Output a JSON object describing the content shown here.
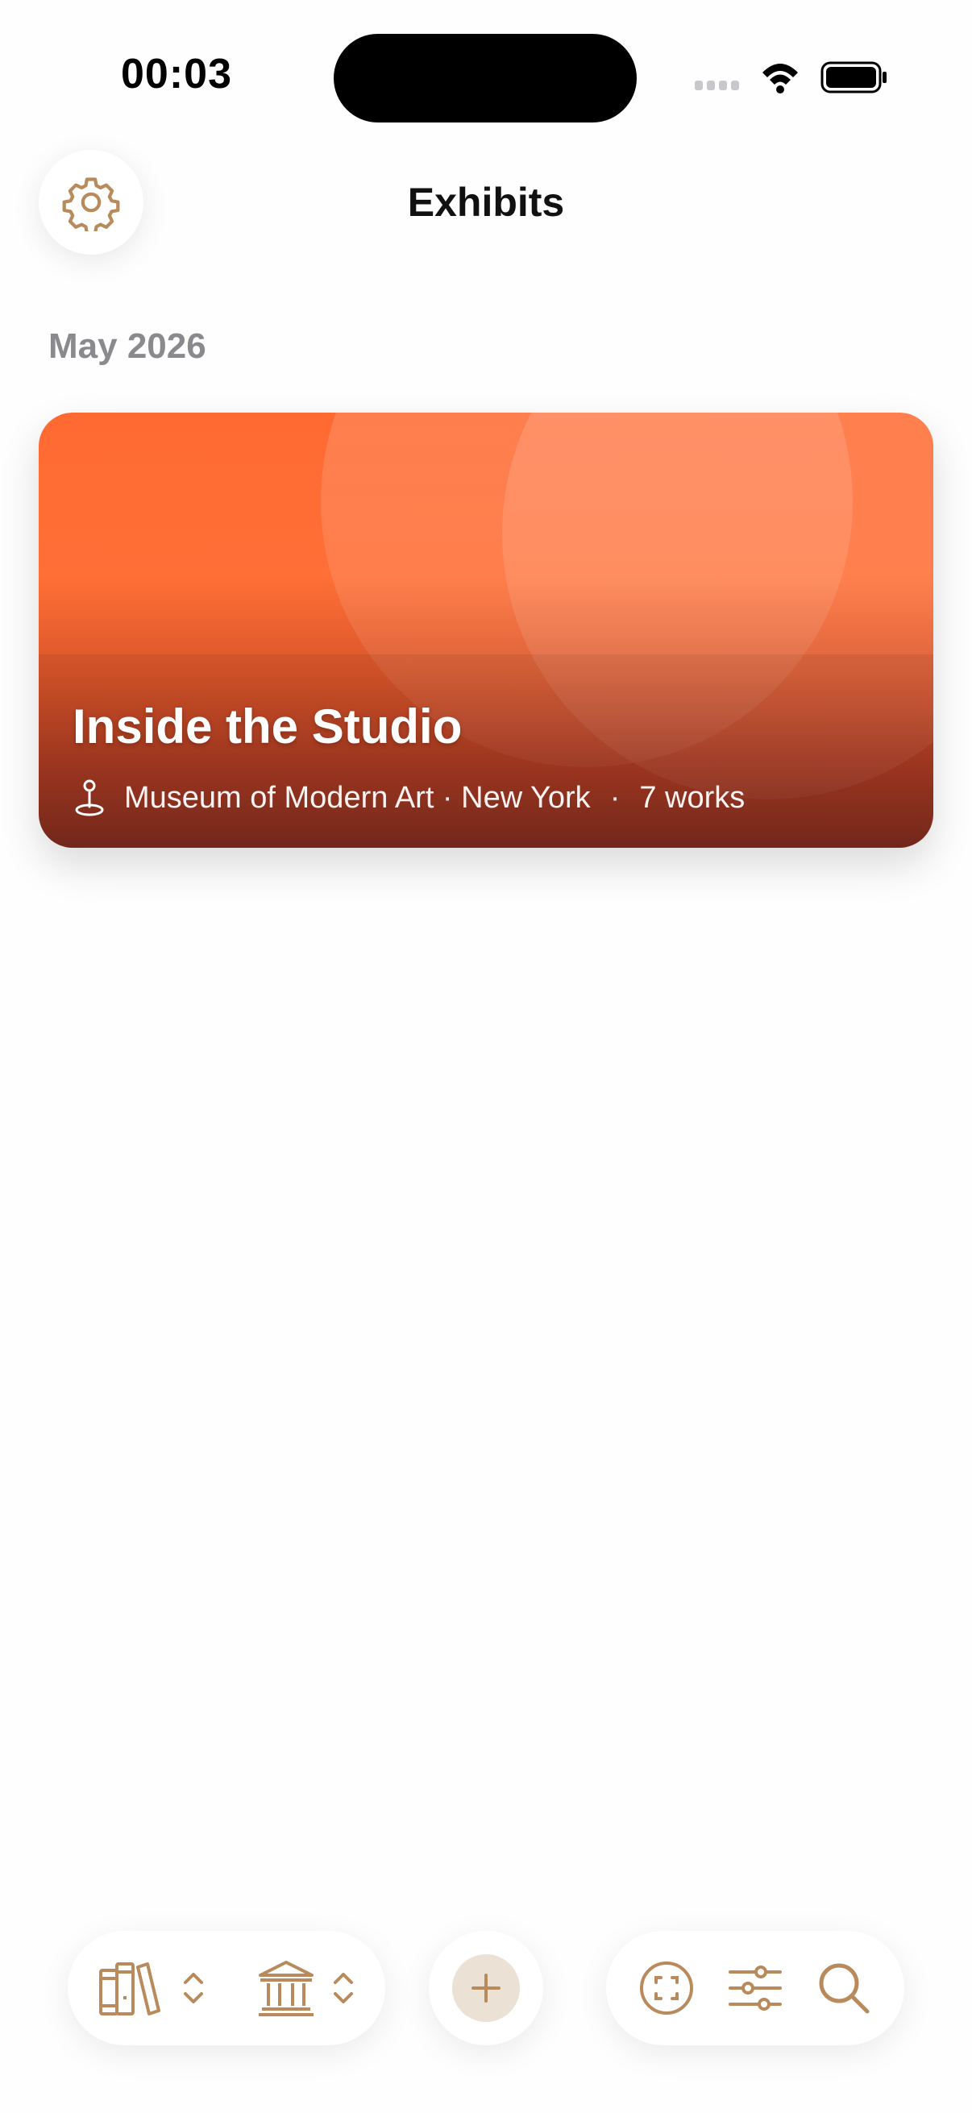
{
  "status_bar": {
    "time": "00:03"
  },
  "header": {
    "title": "Exhibits",
    "settings_icon": "gear-icon"
  },
  "sections": [
    {
      "label": "May 2026",
      "exhibits": [
        {
          "title": "Inside the Studio",
          "location": "Museum of Modern Art · New York",
          "separator": "·",
          "works": "7 works"
        }
      ]
    }
  ],
  "toolbar": {
    "left": [
      "books-icon",
      "chevron-updown-icon",
      "museum-icon",
      "chevron-updown-icon"
    ],
    "middle": [
      "add-icon"
    ],
    "right": [
      "scan-face-icon",
      "sliders-icon",
      "search-icon"
    ]
  },
  "colors": {
    "accent": "#b88a5c",
    "accent_light": "#ebe1d5",
    "card_top": "#ff6a32",
    "card_bottom": "#7a2a1d",
    "section_label": "#8a8a8e"
  }
}
